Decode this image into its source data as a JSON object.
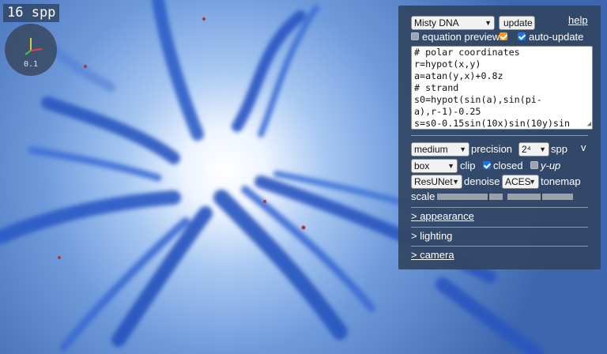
{
  "overlay": {
    "spp_label": "16 spp",
    "axes_scale": "0.1"
  },
  "panel": {
    "preset_select": "Misty DNA",
    "update_label": "update",
    "help_label": "help",
    "equation_preview": {
      "label": "equation preview",
      "checked": false
    },
    "auto_update": {
      "label": "auto-update",
      "checked": true
    },
    "code_lines": [
      "# polar coordinates",
      "r=hypot(x,y)",
      "a=atan(y,x)+0.8z",
      "# strand",
      "s0=hypot(sin(a),sin(pi-",
      "a),r-1)-0.25",
      "s=s0-0.15sin(10x)sin(10y)sin"
    ],
    "precision_select": "medium",
    "precision_label": "precision",
    "spp_select": "2⁴",
    "spp_label": "spp",
    "v_label": "v",
    "clip_select": "box",
    "clip_label": "clip",
    "closed": {
      "label": "closed",
      "checked": true
    },
    "y_up": {
      "label": "y-up",
      "checked": false
    },
    "denoise_select": "ResUNet",
    "denoise_label": "denoise",
    "tonemap_select": "ACES",
    "tonemap_label": "tonemap",
    "scale_label": "scale",
    "scale_slider_1": 0.77,
    "scale_slider_2": 0.5,
    "sections": [
      "> appearance",
      "> lighting",
      "> camera"
    ]
  },
  "colors": {
    "panel_bg": "#324664",
    "checkbox_blue": "#1a73e8",
    "checkbox_orange": "#f29a1d"
  }
}
